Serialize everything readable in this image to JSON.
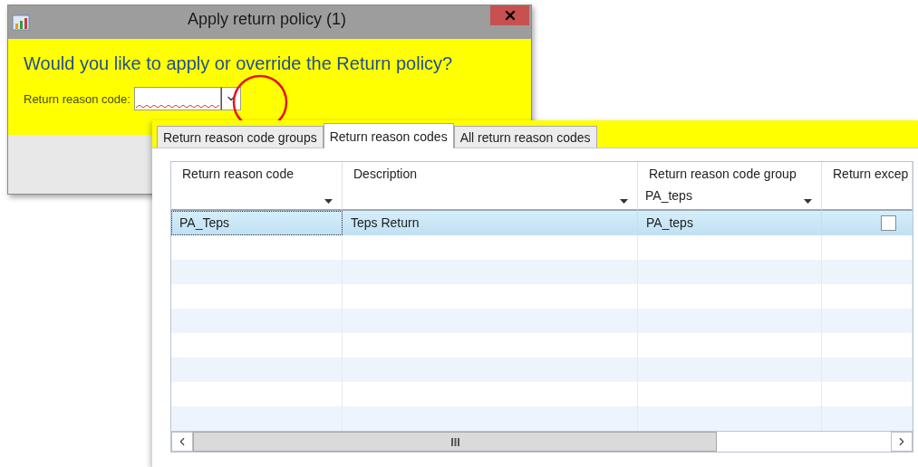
{
  "window": {
    "title": "Apply return policy (1)"
  },
  "prompt": "Would you like to apply or override the Return policy?",
  "field": {
    "label": "Return reason code:",
    "error": true
  },
  "tabs": [
    {
      "label": "Return reason code groups",
      "selected": false
    },
    {
      "label": "Return reason codes",
      "selected": true
    },
    {
      "label": "All return reason codes",
      "selected": false
    }
  ],
  "table": {
    "columns": [
      {
        "label": "Return reason code",
        "dropdown": true
      },
      {
        "label": "Description",
        "dropdown": true
      },
      {
        "label": "Return reason code group",
        "filter": "PA_teps",
        "dropdown": true
      },
      {
        "label": "Return excep",
        "dropdown": false
      }
    ],
    "rows": [
      {
        "cells": [
          "PA_Teps",
          "Teps Return",
          "PA_teps"
        ],
        "checked": false,
        "selected": true
      }
    ]
  }
}
